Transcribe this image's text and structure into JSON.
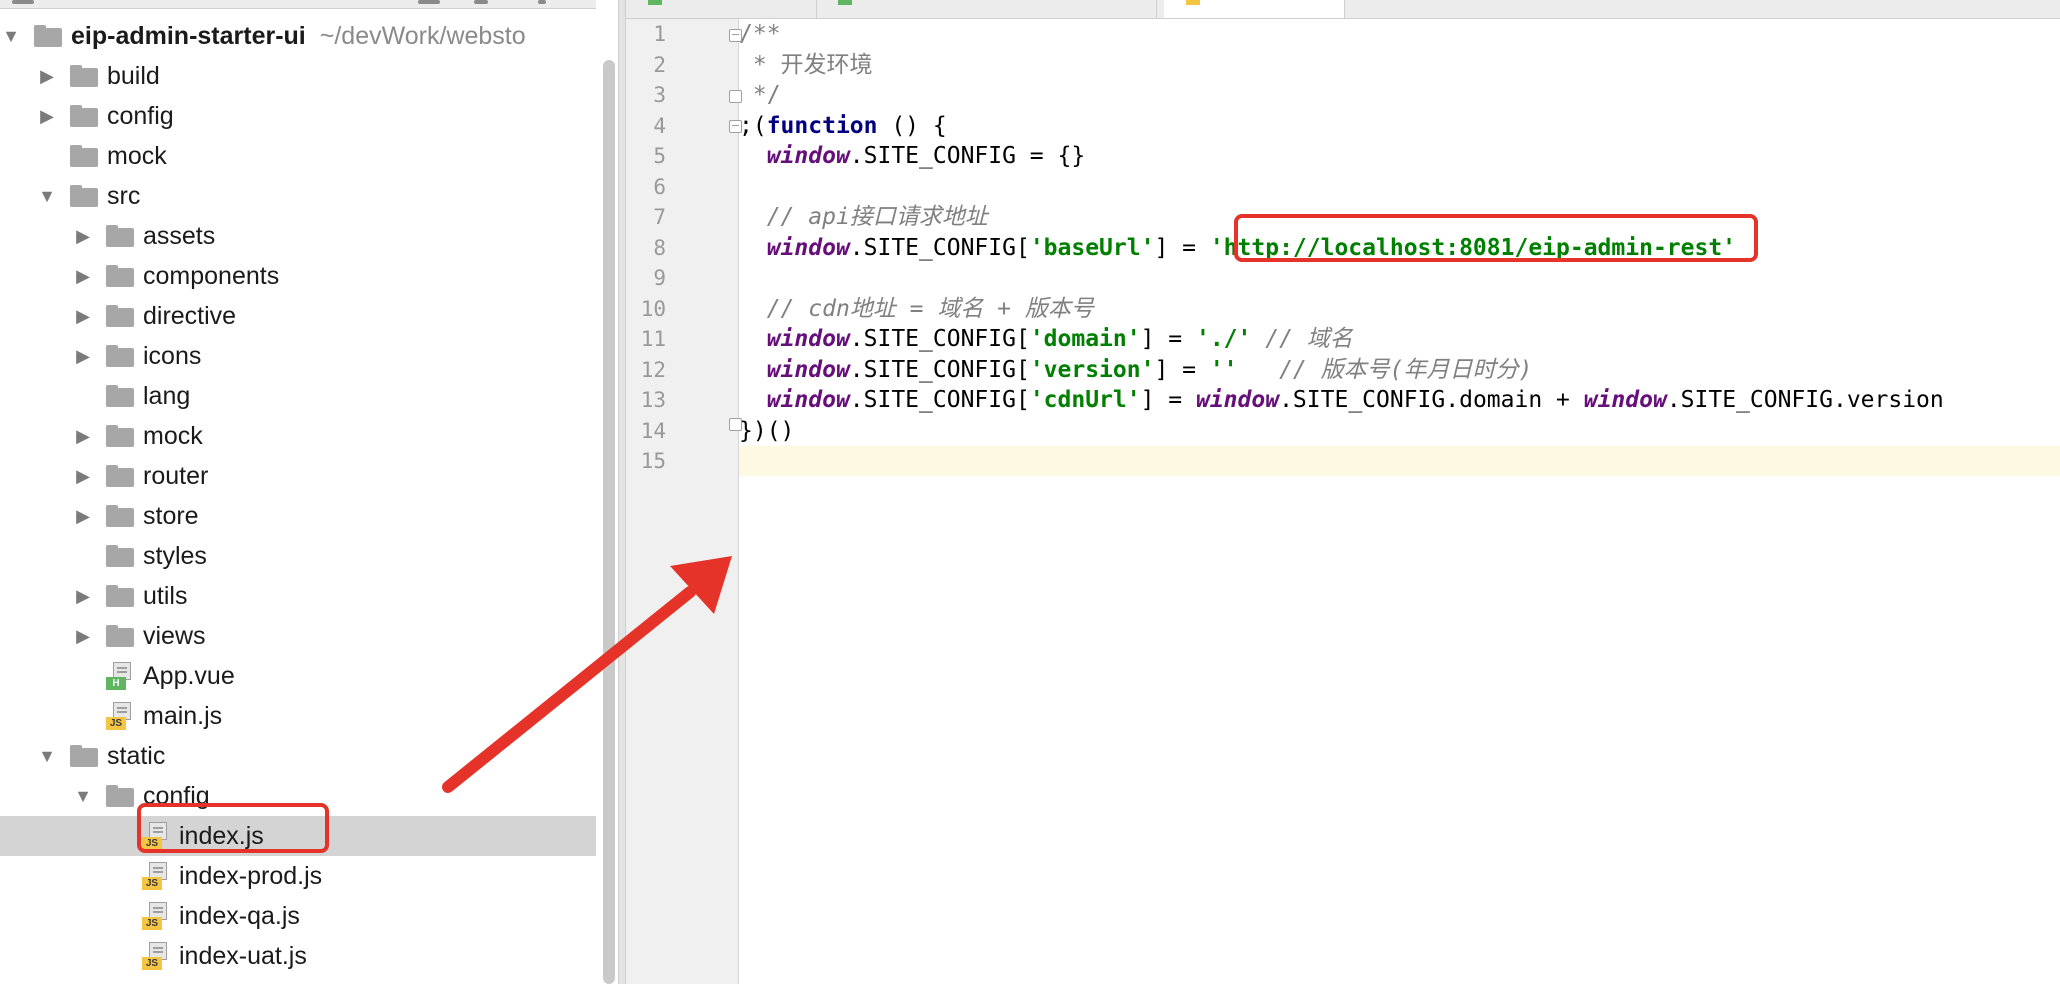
{
  "project": {
    "root": {
      "label": "eip-admin-starter-ui",
      "path": "~/devWork/websto"
    },
    "items": [
      {
        "label": "build",
        "kind": "folder",
        "level": 1,
        "state": "collapsed"
      },
      {
        "label": "config",
        "kind": "folder",
        "level": 1,
        "state": "collapsed"
      },
      {
        "label": "mock",
        "kind": "folder",
        "level": 1,
        "state": "leaf"
      },
      {
        "label": "src",
        "kind": "folder",
        "level": 1,
        "state": "expanded"
      },
      {
        "label": "assets",
        "kind": "folder",
        "level": 2,
        "state": "collapsed"
      },
      {
        "label": "components",
        "kind": "folder",
        "level": 2,
        "state": "collapsed"
      },
      {
        "label": "directive",
        "kind": "folder",
        "level": 2,
        "state": "collapsed"
      },
      {
        "label": "icons",
        "kind": "folder",
        "level": 2,
        "state": "collapsed"
      },
      {
        "label": "lang",
        "kind": "folder",
        "level": 2,
        "state": "leaf"
      },
      {
        "label": "mock",
        "kind": "folder",
        "level": 2,
        "state": "collapsed"
      },
      {
        "label": "router",
        "kind": "folder",
        "level": 2,
        "state": "collapsed"
      },
      {
        "label": "store",
        "kind": "folder",
        "level": 2,
        "state": "collapsed"
      },
      {
        "label": "styles",
        "kind": "folder",
        "level": 2,
        "state": "leaf"
      },
      {
        "label": "utils",
        "kind": "folder",
        "level": 2,
        "state": "collapsed"
      },
      {
        "label": "views",
        "kind": "folder",
        "level": 2,
        "state": "collapsed"
      },
      {
        "label": "App.vue",
        "kind": "vue",
        "level": 2,
        "state": "leaf"
      },
      {
        "label": "main.js",
        "kind": "js",
        "level": 2,
        "state": "leaf"
      },
      {
        "label": "static",
        "kind": "folder",
        "level": 1,
        "state": "expanded"
      },
      {
        "label": "config",
        "kind": "folder",
        "level": 2,
        "state": "expanded"
      },
      {
        "label": "index.js",
        "kind": "js",
        "level": 3,
        "state": "leaf",
        "selected": true
      },
      {
        "label": "index-prod.js",
        "kind": "js",
        "level": 3,
        "state": "leaf"
      },
      {
        "label": "index-qa.js",
        "kind": "js",
        "level": 3,
        "state": "leaf"
      },
      {
        "label": "index-uat.js",
        "kind": "js",
        "level": 3,
        "state": "leaf"
      }
    ]
  },
  "editor": {
    "line_numbers": [
      "1",
      "2",
      "3",
      "4",
      "5",
      "6",
      "7",
      "8",
      "9",
      "10",
      "11",
      "12",
      "13",
      "14",
      "15"
    ],
    "lines": [
      [
        {
          "c": "doc",
          "t": "/**"
        }
      ],
      [
        {
          "c": "doc",
          "t": " * 开发环境"
        }
      ],
      [
        {
          "c": "doc",
          "t": " */"
        }
      ],
      [
        {
          "c": "plain",
          "t": ";("
        },
        {
          "c": "kw",
          "t": "function"
        },
        {
          "c": "plain",
          "t": " () {"
        }
      ],
      [
        {
          "c": "plain",
          "t": "  "
        },
        {
          "c": "win",
          "t": "window"
        },
        {
          "c": "plain",
          "t": ".SITE_CONFIG = {}"
        }
      ],
      [],
      [
        {
          "c": "plain",
          "t": "  "
        },
        {
          "c": "comment",
          "t": "// api接口请求地址"
        }
      ],
      [
        {
          "c": "plain",
          "t": "  "
        },
        {
          "c": "win",
          "t": "window"
        },
        {
          "c": "plain",
          "t": ".SITE_CONFIG["
        },
        {
          "c": "str",
          "t": "'baseUrl'"
        },
        {
          "c": "plain",
          "t": "] = "
        },
        {
          "c": "str",
          "t": "'http://localhost:8081/eip-admin-rest'"
        }
      ],
      [],
      [
        {
          "c": "plain",
          "t": "  "
        },
        {
          "c": "comment",
          "t": "// cdn地址 = 域名 + 版本号"
        }
      ],
      [
        {
          "c": "plain",
          "t": "  "
        },
        {
          "c": "win",
          "t": "window"
        },
        {
          "c": "plain",
          "t": ".SITE_CONFIG["
        },
        {
          "c": "str",
          "t": "'domain'"
        },
        {
          "c": "plain",
          "t": "] = "
        },
        {
          "c": "str",
          "t": "'./'"
        },
        {
          "c": "plain",
          "t": " "
        },
        {
          "c": "comment",
          "t": "// 域名"
        }
      ],
      [
        {
          "c": "plain",
          "t": "  "
        },
        {
          "c": "win",
          "t": "window"
        },
        {
          "c": "plain",
          "t": ".SITE_CONFIG["
        },
        {
          "c": "str",
          "t": "'version'"
        },
        {
          "c": "plain",
          "t": "] = "
        },
        {
          "c": "str",
          "t": "''"
        },
        {
          "c": "plain",
          "t": "   "
        },
        {
          "c": "comment",
          "t": "// 版本号(年月日时分)"
        }
      ],
      [
        {
          "c": "plain",
          "t": "  "
        },
        {
          "c": "win",
          "t": "window"
        },
        {
          "c": "plain",
          "t": ".SITE_CONFIG["
        },
        {
          "c": "str",
          "t": "'cdnUrl'"
        },
        {
          "c": "plain",
          "t": "] = "
        },
        {
          "c": "win",
          "t": "window"
        },
        {
          "c": "plain",
          "t": ".SITE_CONFIG.domain + "
        },
        {
          "c": "win",
          "t": "window"
        },
        {
          "c": "plain",
          "t": ".SITE_CONFIG.version"
        }
      ],
      [
        {
          "c": "plain",
          "t": "})()"
        }
      ],
      []
    ],
    "current_line": 15
  },
  "colors": {
    "selection_bg": "#d4d4d4",
    "highlight_red": "#e6332a",
    "string_green": "#008000",
    "keyword_navy": "#000080",
    "window_purple": "#660e7a",
    "comment_gray": "#808080"
  }
}
